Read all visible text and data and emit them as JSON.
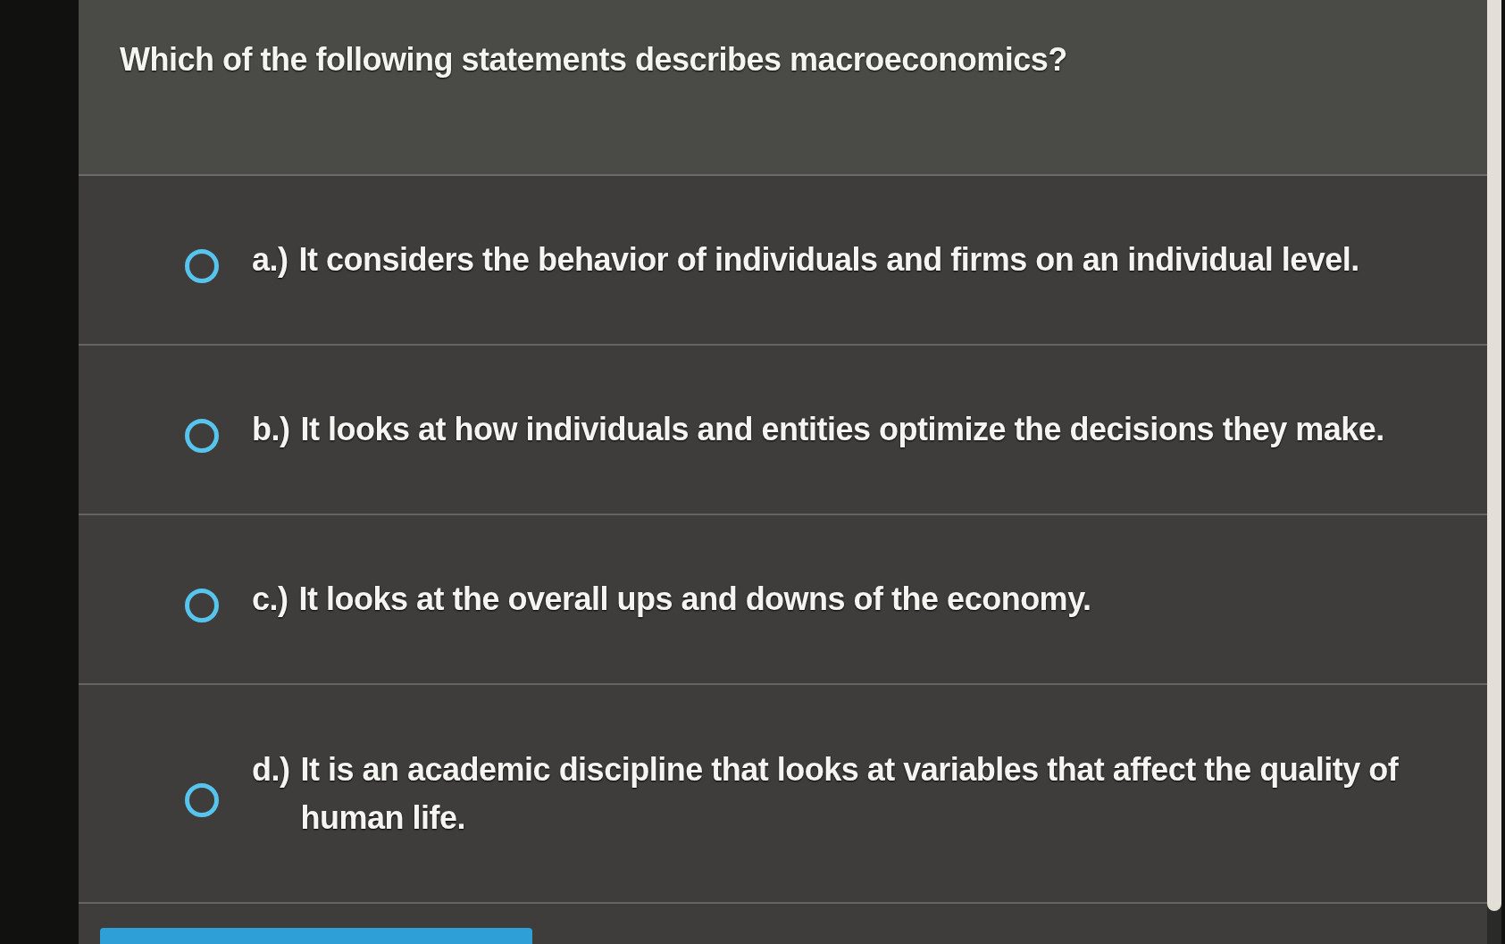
{
  "question": "Which of the following statements describes macroeconomics?",
  "options": [
    {
      "letter": "a.)",
      "text": "It considers the behavior of individuals and firms on an individual level.",
      "selected": false
    },
    {
      "letter": "b.)",
      "text": "It looks at how individuals and entities optimize the decisions they make.",
      "selected": false
    },
    {
      "letter": "c.)",
      "text": "It looks at the overall ups and downs of the economy.",
      "selected": false
    },
    {
      "letter": "d.)",
      "text": "It is an academic discipline that looks at variables that affect the quality of human life.",
      "selected": false
    }
  ]
}
